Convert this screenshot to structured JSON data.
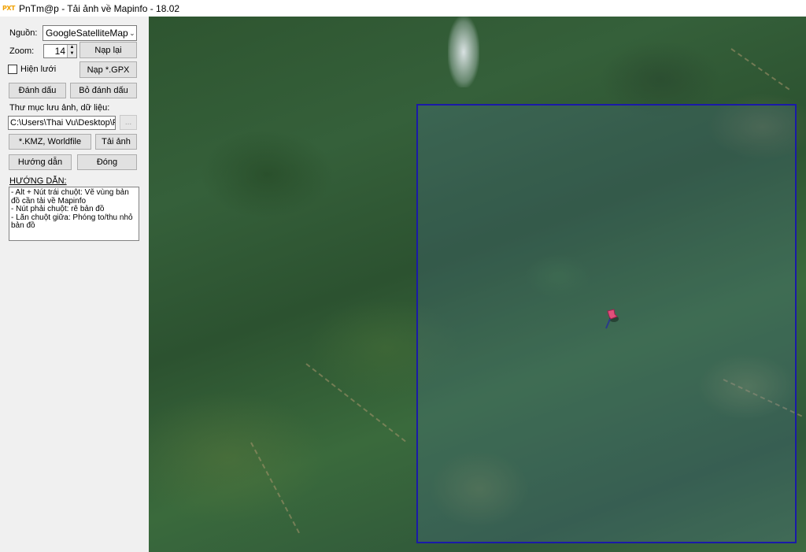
{
  "window": {
    "logo": "PXT",
    "title": "PnTm@p - Tải ảnh về Mapinfo - 18.02"
  },
  "panel": {
    "source_label": "Nguồn:",
    "source_value": "GoogleSatelliteMap",
    "zoom_label": "Zoom:",
    "zoom_value": "14",
    "reload_button": "Nạp lại",
    "grid_checkbox_label": "Hiện lưới",
    "grid_checked": false,
    "load_gpx_button": "Nạp *.GPX",
    "mark_button": "Đánh dấu",
    "unmark_button": "Bỏ đánh dấu",
    "folder_label": "Thư mục lưu  ảnh, dữ liệu:",
    "folder_path": "C:\\Users\\Thai Vu\\Desktop\\Pn",
    "browse_button": "...",
    "kmz_button": "*.KMZ, Worldfile",
    "download_button": "Tải ảnh",
    "help_button": "Hướng dẫn",
    "close_button": "Đóng",
    "guide_heading": "HƯỚNG DẪN:",
    "guide_lines": [
      "- Alt + Nút trái chuột: Vẽ vùng bản đồ cần tải về Mapinfo",
      "- Nút phải chuột: rê bản đồ",
      "- Lăn chuột giữa: Phóng to/thu nhỏ bản đồ"
    ]
  },
  "map": {
    "selection_color": "#1a1aa8",
    "pin_color": "#e0507a",
    "icon": "map-pin-icon"
  }
}
